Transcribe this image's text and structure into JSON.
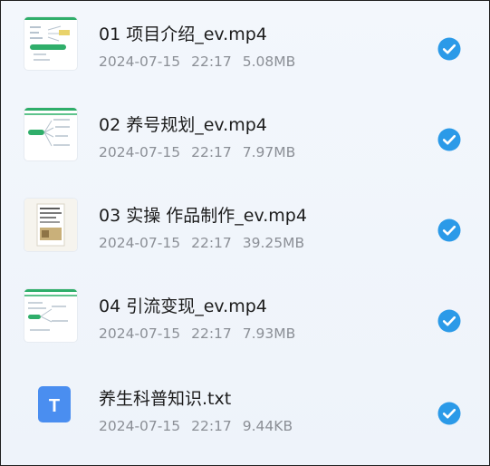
{
  "files": [
    {
      "name": "01 项目介绍_ev.mp4",
      "date": "2024-07-15",
      "time": "22:17",
      "size": "5.08MB",
      "icon": "video-thumbnail-mindmap",
      "selected": true
    },
    {
      "name": "02 养号规划_ev.mp4",
      "date": "2024-07-15",
      "time": "22:17",
      "size": "7.97MB",
      "icon": "video-thumbnail-mindmap",
      "selected": true
    },
    {
      "name": "03 实操 作品制作_ev.mp4",
      "date": "2024-07-15",
      "time": "22:17",
      "size": "39.25MB",
      "icon": "video-thumbnail-document",
      "selected": true
    },
    {
      "name": "04 引流变现_ev.mp4",
      "date": "2024-07-15",
      "time": "22:17",
      "size": "7.93MB",
      "icon": "video-thumbnail-mindmap",
      "selected": true
    },
    {
      "name": "养生科普知识.txt",
      "date": "2024-07-15",
      "time": "22:17",
      "size": "9.44KB",
      "icon": "txt-file-icon",
      "selected": true
    }
  ],
  "txt_icon_letter": "T",
  "colors": {
    "check": "#2b9ae8",
    "txt_icon": "#4a8ef0",
    "accent_green": "#2fae6a"
  }
}
